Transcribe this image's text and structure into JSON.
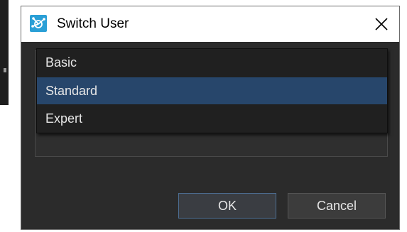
{
  "window": {
    "title": "Switch User",
    "icon": "switch-user-app-icon",
    "close_glyph": "✕"
  },
  "dropdown": {
    "options": [
      {
        "label": "Basic",
        "selected": false
      },
      {
        "label": "Standard",
        "selected": true
      },
      {
        "label": "Expert",
        "selected": false
      }
    ]
  },
  "buttons": {
    "ok_label": "OK",
    "cancel_label": "Cancel"
  },
  "colors": {
    "selected_bg": "#27466b",
    "dialog_bg": "#2b2b2b",
    "icon_accent": "#2a9fd6"
  }
}
